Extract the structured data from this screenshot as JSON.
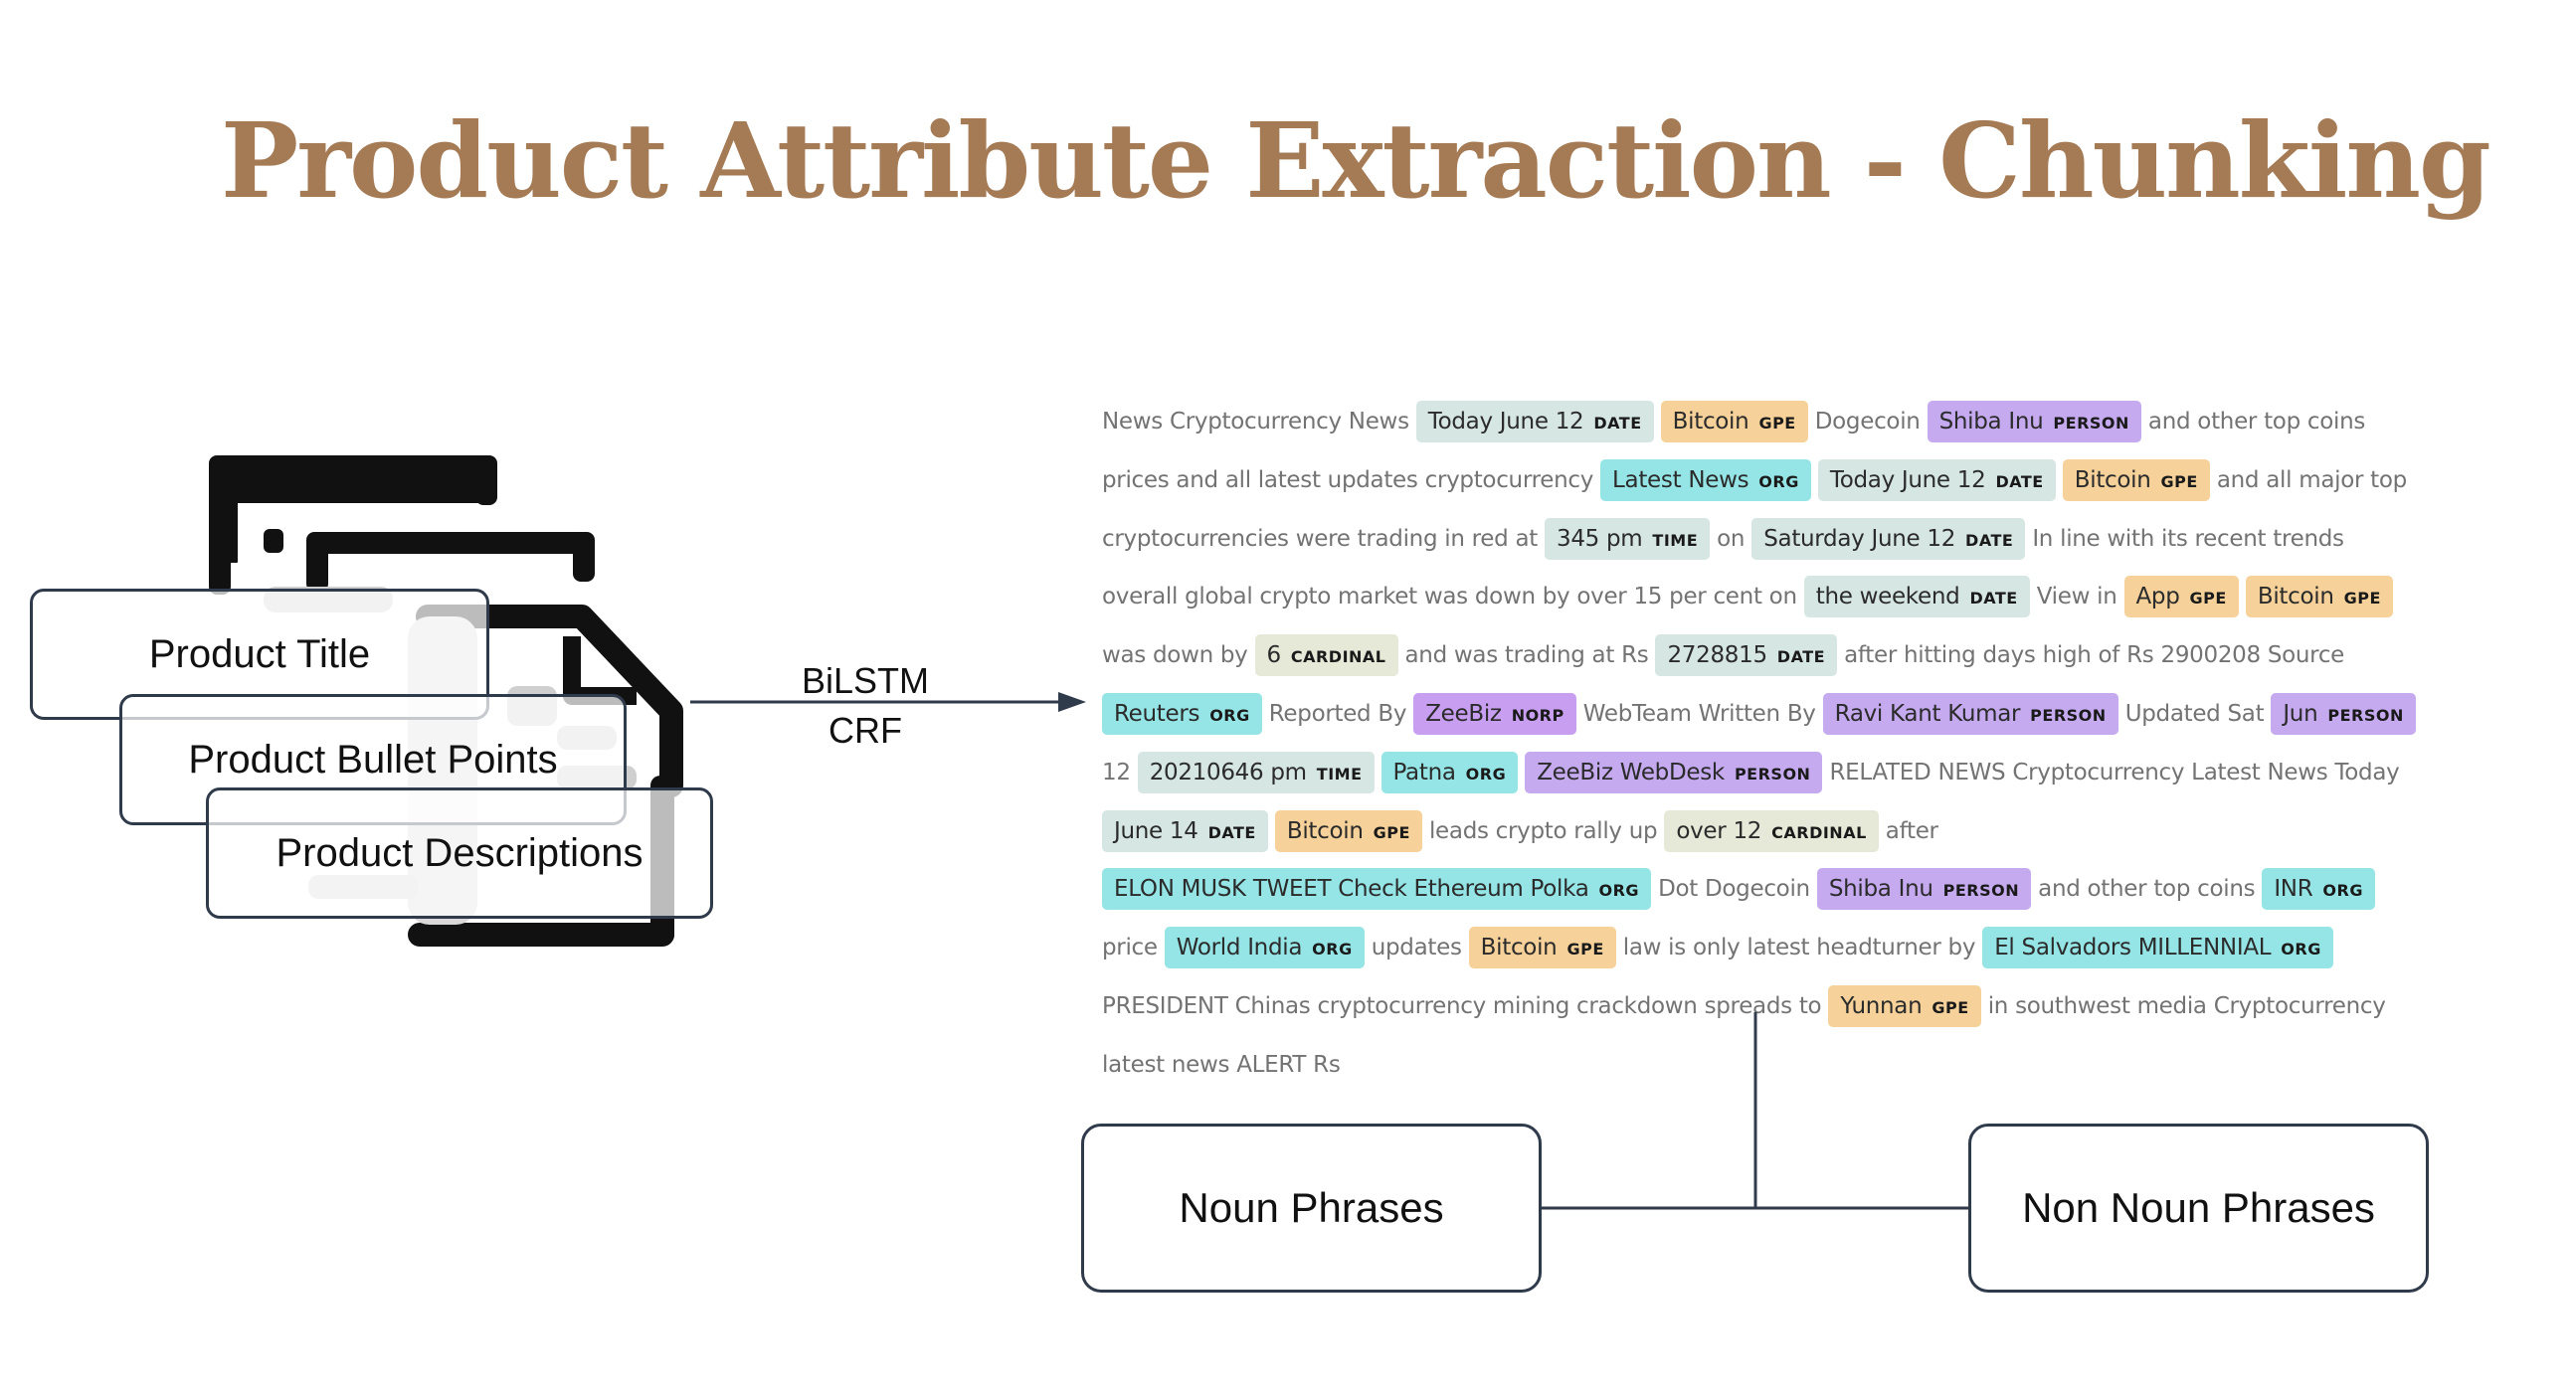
{
  "title": "Product Attribute Extraction - Chunking",
  "inputs": {
    "title_label": "Product Title",
    "bullets_label": "Product Bullet Points",
    "descriptions_label": "Product Descriptions"
  },
  "model": {
    "line1": "BiLSTM",
    "line2": "CRF"
  },
  "ner_sample": [
    {
      "text": "News Cryptocurrency News"
    },
    {
      "text": "Today June 12",
      "label": "DATE"
    },
    {
      "text": "Bitcoin",
      "label": "GPE"
    },
    {
      "text": "Dogecoin"
    },
    {
      "text": "Shiba Inu",
      "label": "PERSON"
    },
    {
      "text": "and other top coins prices and all latest updates cryptocurrency"
    },
    {
      "text": "Latest News",
      "label": "ORG"
    },
    {
      "text": "Today June 12",
      "label": "DATE"
    },
    {
      "text": "Bitcoin",
      "label": "GPE"
    },
    {
      "text": "and all major top cryptocurrencies were trading in red at"
    },
    {
      "text": "345 pm",
      "label": "TIME"
    },
    {
      "text": "on"
    },
    {
      "text": "Saturday June 12",
      "label": "DATE"
    },
    {
      "text": "In line with its recent trends overall global crypto market was down by over 15 per cent on"
    },
    {
      "text": "the weekend",
      "label": "DATE"
    },
    {
      "text": "View in"
    },
    {
      "text": "App",
      "label": "GPE"
    },
    {
      "text": "Bitcoin",
      "label": "GPE"
    },
    {
      "text": "was down by"
    },
    {
      "text": "6",
      "label": "CARDINAL"
    },
    {
      "text": "and was trading at Rs"
    },
    {
      "text": "2728815",
      "label": "DATE"
    },
    {
      "text": "after hitting days high of Rs 2900208 Source"
    },
    {
      "text": "Reuters",
      "label": "ORG"
    },
    {
      "text": "Reported By"
    },
    {
      "text": "ZeeBiz",
      "label": "NORP"
    },
    {
      "text": "WebTeam Written By"
    },
    {
      "text": "Ravi Kant Kumar",
      "label": "PERSON"
    },
    {
      "text": "Updated Sat"
    },
    {
      "text": "Jun",
      "label": "PERSON"
    },
    {
      "text": "12"
    },
    {
      "text": "20210646 pm",
      "label": "TIME"
    },
    {
      "text": "Patna",
      "label": "ORG"
    },
    {
      "text": "ZeeBiz WebDesk",
      "label": "PERSON"
    },
    {
      "text": "RELATED NEWS Cryptocurrency Latest News Today"
    },
    {
      "text": "June 14",
      "label": "DATE"
    },
    {
      "text": "Bitcoin",
      "label": "GPE"
    },
    {
      "text": "leads crypto rally up"
    },
    {
      "text": "over 12",
      "label": "CARDINAL"
    },
    {
      "text": "after"
    },
    {
      "text": "ELON MUSK TWEET Check Ethereum Polka",
      "label": "ORG"
    },
    {
      "text": "Dot Dogecoin"
    },
    {
      "text": "Shiba Inu",
      "label": "PERSON"
    },
    {
      "text": "and other top coins"
    },
    {
      "text": "INR",
      "label": "ORG"
    },
    {
      "text": "price"
    },
    {
      "text": "World India",
      "label": "ORG"
    },
    {
      "text": "updates"
    },
    {
      "text": "Bitcoin",
      "label": "GPE"
    },
    {
      "text": "law is only latest headturner by"
    },
    {
      "text": "El Salvadors MILLENNIAL",
      "label": "ORG"
    },
    {
      "text": "PRESIDENT Chinas cryptocurrency mining crackdown spreads to"
    },
    {
      "text": "Yunnan",
      "label": "GPE"
    },
    {
      "text": "in southwest media Cryptocurrency latest news ALERT Rs"
    }
  ],
  "outputs": {
    "noun_label": "Noun Phrases",
    "non_noun_label": "Non Noun Phrases"
  },
  "colors": {
    "title": "#a57b55",
    "DATE": "#d6e6e2",
    "GPE": "#f6d29a",
    "ORG": "#96e5e6",
    "PERSON": "#c5aaf0",
    "TIME": "#d6e6e2",
    "CARDINAL": "#e6e8d8",
    "NORP": "#c89ef1"
  }
}
